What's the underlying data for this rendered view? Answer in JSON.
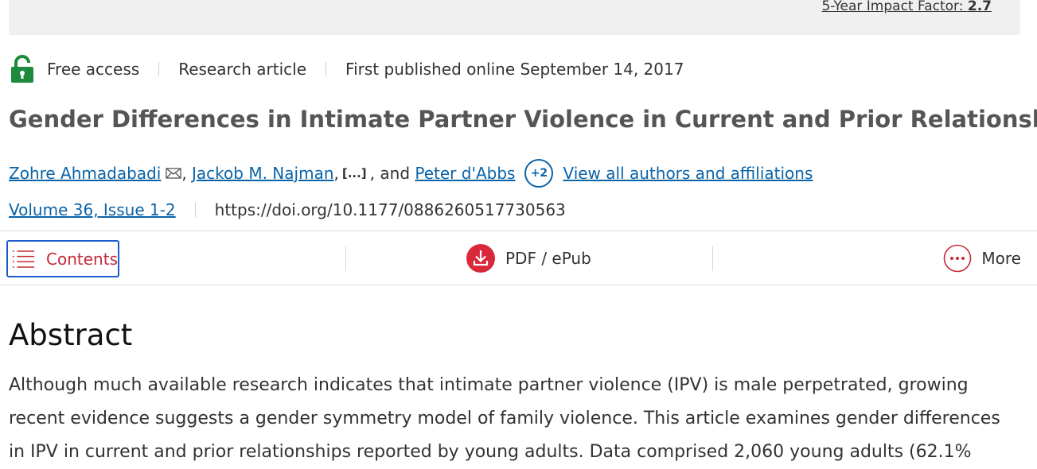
{
  "banner": {
    "impact_label": "5-Year Impact Factor:",
    "impact_value": "2.7"
  },
  "meta": {
    "access": "Free access",
    "article_type": "Research article",
    "published": "First published online September 14, 2017"
  },
  "article": {
    "title": "Gender Differences in Intimate Partner Violence in Current and Prior Relationships"
  },
  "authors": {
    "author_1": "Zohre Ahmadabadi",
    "author_2": "Jackob M. Najman",
    "ellipsis": "[...]",
    "and_text": ", and",
    "author_3": "Peter d'Abbs",
    "more_count": "+2",
    "view_all": "View all authors and affiliations"
  },
  "publication": {
    "volume": "Volume 36, Issue 1-2",
    "doi": "https://doi.org/10.1177/0886260517730563"
  },
  "toolbar": {
    "contents": "Contents",
    "pdf": "PDF / ePub",
    "more": "More"
  },
  "abstract": {
    "heading": "Abstract",
    "text": "Although much available research indicates that intimate partner violence (IPV) is male perpetrated, growing recent evidence suggests a gender symmetry model of family violence. This article examines gender differences in IPV in current and prior relationships reported by young adults. Data comprised 2,060 young adults (62.1%"
  },
  "colors": {
    "link": "#0a63a8",
    "accent_red": "#c52a3a",
    "lock_green": "#1e8a3c",
    "focus_blue": "#1a5ccc"
  },
  "icons": {
    "lock": "lock-icon",
    "mail": "mail-icon",
    "list": "list-icon",
    "download": "download-icon",
    "more": "more-dots-icon"
  }
}
